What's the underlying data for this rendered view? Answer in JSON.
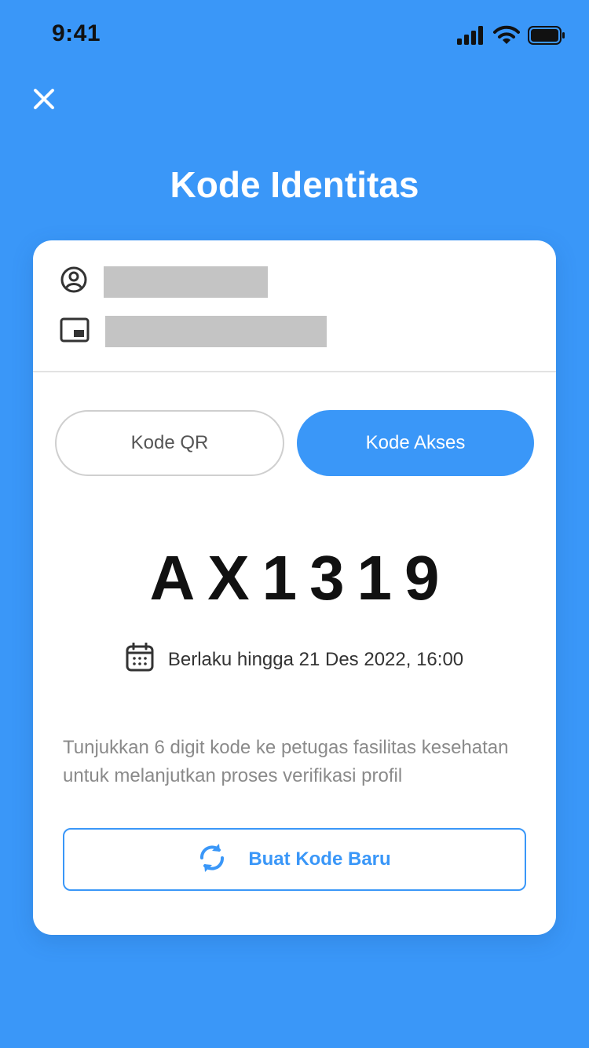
{
  "status_bar": {
    "time": "9:41"
  },
  "header": {
    "title": "Kode Identitas"
  },
  "card": {
    "tabs": [
      {
        "label": "Kode QR",
        "active": false
      },
      {
        "label": "Kode Akses",
        "active": true
      }
    ],
    "access_code": "AX1319",
    "validity_text": "Berlaku hingga 21 Des 2022, 16:00",
    "description": "Tunjukkan 6 digit kode ke petugas fasilitas kesehatan untuk melanjutkan proses verifikasi profil",
    "renew_button_label": "Buat Kode Baru"
  },
  "icons": {
    "close": "close-icon",
    "user": "user-circle-icon",
    "id_card": "id-card-icon",
    "calendar": "calendar-icon",
    "refresh": "refresh-icon",
    "signal": "cellular-signal-icon",
    "wifi": "wifi-icon",
    "battery": "battery-icon"
  },
  "colors": {
    "primary": "#3A97F8",
    "background": "#3A97F8",
    "card": "#FFFFFF",
    "placeholder": "#C4C4C4",
    "text_dark": "#111111",
    "text_muted": "#8A8A8A"
  }
}
